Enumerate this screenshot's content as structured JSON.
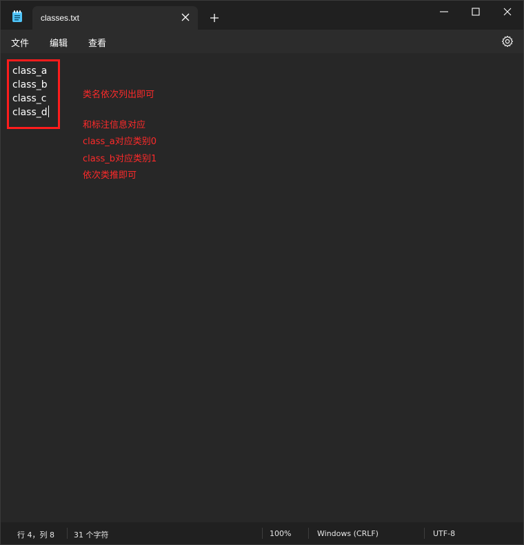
{
  "tab": {
    "title": "classes.txt"
  },
  "menu": {
    "file": "文件",
    "edit": "编辑",
    "view": "查看"
  },
  "editor": {
    "lines": [
      "class_a",
      "class_b",
      "class_c",
      "class_d"
    ]
  },
  "annotations": {
    "a1": "类名依次列出即可",
    "a2": "和标注信息对应",
    "a3": "class_a对应类别0",
    "a4": "class_b对应类别1",
    "a5": "依次类推即可"
  },
  "status": {
    "position": "行 4，列 8",
    "chars": "31 个字符",
    "zoom": "100%",
    "line_ending": "Windows (CRLF)",
    "encoding": "UTF-8"
  },
  "colors": {
    "annotation": "#ff2a2a",
    "highlight": "#ff1c1c",
    "app_icon": "#4fc3f7"
  },
  "icons": {
    "app": "notepad-icon",
    "close_tab": "close-icon",
    "new_tab": "plus-icon",
    "minimize": "minimize-icon",
    "maximize": "maximize-icon",
    "close": "close-icon",
    "settings": "gear-icon"
  }
}
